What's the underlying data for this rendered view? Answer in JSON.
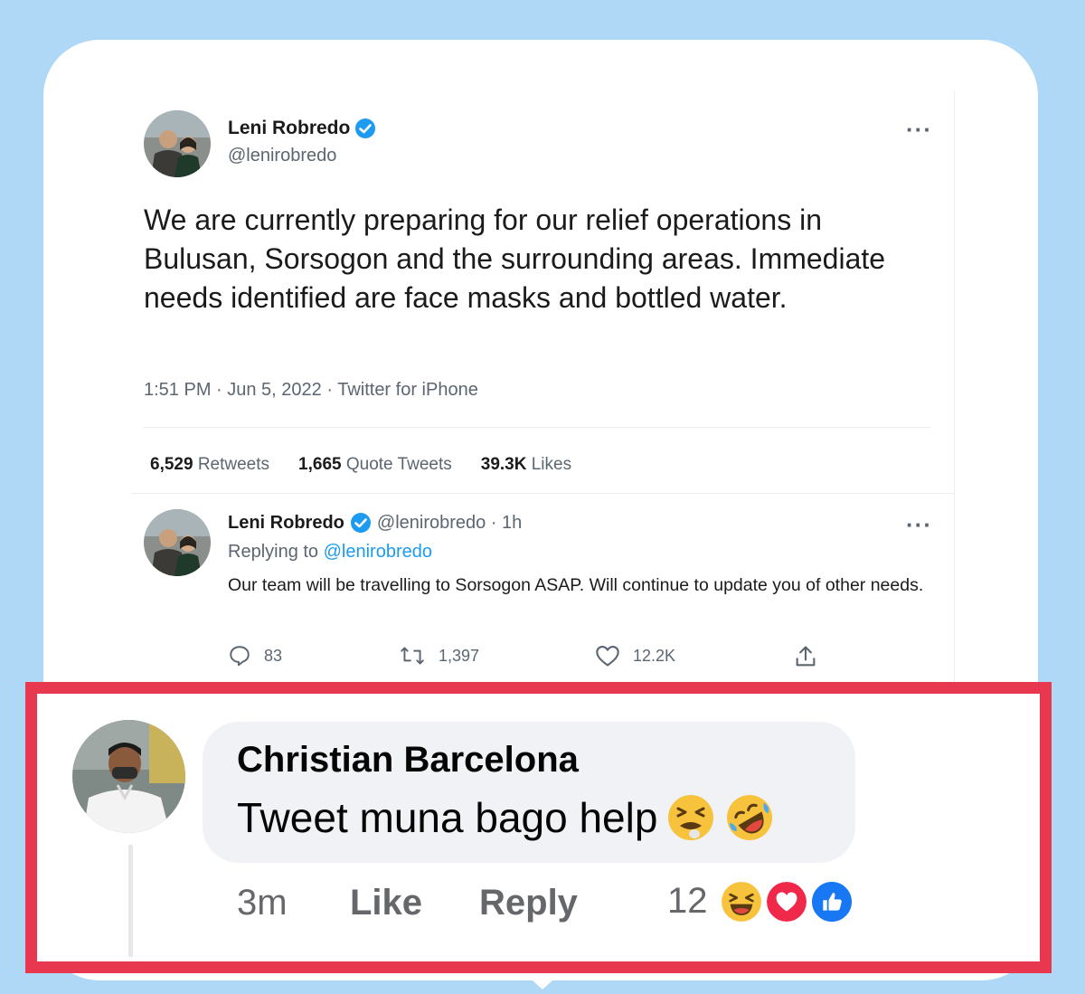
{
  "tweet": {
    "author_name": "Leni Robredo",
    "author_handle": "@lenirobredo",
    "body": "We are currently preparing for our relief operations in Bulusan, Sorsogon and the surrounding areas. Immediate needs identified are face masks and bottled water.",
    "meta": "1:51 PM · Jun 5, 2022 · Twitter for iPhone",
    "stats": {
      "retweets_count": "6,529",
      "retweets_label": "Retweets",
      "quotes_count": "1,665",
      "quotes_label": "Quote Tweets",
      "likes_count": "39.3K",
      "likes_label": "Likes"
    },
    "more_icon": "ellipsis-icon",
    "verified_icon": "verified-badge-icon",
    "colors": {
      "link": "#1d9bf0",
      "verified": "#1d9bf0",
      "secondary_text": "#5b6670"
    }
  },
  "reply": {
    "author_name": "Leni Robredo",
    "handle_time": "@lenirobredo · 1h",
    "replying_prefix": "Replying to",
    "replying_handle": "@lenirobredo",
    "body": "Our team will be travelling to Sorsogon ASAP. Will continue to update you of other needs.",
    "actions": {
      "reply_count": "83",
      "retweet_count": "1,397",
      "like_count": "12.2K"
    },
    "icons": [
      "comment-icon",
      "retweet-icon",
      "heart-icon",
      "share-icon"
    ]
  },
  "fb_comment": {
    "author_name": "Christian Barcelona",
    "text": "Tweet muna bago help",
    "emojis": [
      "tired-face-emoji",
      "rolling-on-floor-laughing-emoji"
    ],
    "time": "3m",
    "like_label": "Like",
    "reply_label": "Reply",
    "reaction_count": "12",
    "reactions": [
      "haha-reaction",
      "love-reaction",
      "like-reaction"
    ],
    "colors": {
      "highlight_border": "#e8384f",
      "bubble": "#f0f2f5",
      "background": "#aed8f6"
    }
  }
}
